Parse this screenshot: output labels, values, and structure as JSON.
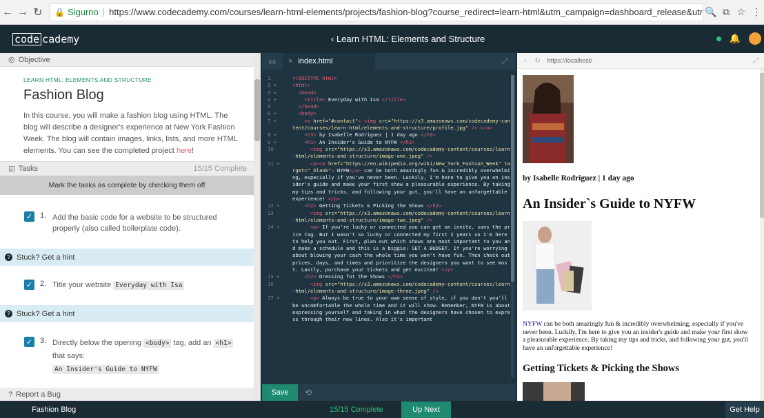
{
  "browser": {
    "secure_label": "Sigurno",
    "url": "https://www.codecademy.com/courses/learn-html-elements/projects/fashion-blog?course_redirect=learn-html&utm_campaign=dashboard_release&utm_source=codecad..."
  },
  "header": {
    "logo_code": "code",
    "logo_rest": "cademy",
    "course_link": "‹ Learn HTML: Elements and Structure"
  },
  "left": {
    "objective_label": "Objective",
    "kicker": "LEARN HTML: ELEMENTS AND STRUCTURE",
    "title": "Fashion Blog",
    "description": "In this course, you will make a fashion blog using HTML. The blog will describe a designer's experience at New York Fashion Week. The blog will contain images, links, lists, and more HTML elements. You can see the completed project ",
    "description_link": "here",
    "description_end": "!",
    "tasks_label": "Tasks",
    "tasks_count": "15/15 Complete",
    "mark_hint": "Mark the tasks as complete by checking them off",
    "tasks": [
      {
        "num": "1.",
        "text": "Add the basic code for a website to be structured properly (also called boilerplate code)."
      },
      {
        "num": "2.",
        "text_before": "Title your website ",
        "code": "Everyday with Isa"
      },
      {
        "num": "3.",
        "text_a": "Directly below the opening ",
        "code_a": "<body>",
        "text_b": " tag, add an ",
        "code_b": "<h1>",
        "text_c": " that says:",
        "code_c": "An Insider's Guide to NYFW"
      }
    ],
    "hint_label": "Stuck? Get a hint",
    "report_label": "Report a Bug"
  },
  "editor": {
    "file_name": "index.html",
    "line_numbers": [
      "1",
      "2 ▾",
      "3 ▾",
      "4 ▾",
      "5",
      "6 ▾",
      "7 ▾",
      "",
      "",
      "8 ▾",
      "9 ▾",
      "10",
      "",
      "11 ▾",
      "",
      "",
      "",
      "",
      "",
      "12 ▾",
      "13",
      "",
      "14 ▾",
      "",
      "",
      "",
      "",
      "",
      "",
      "",
      "",
      "15 ▾",
      "16",
      "",
      "",
      "17 ▾",
      "",
      "",
      ""
    ],
    "save_label": "Save"
  },
  "preview": {
    "url": "https://localhost/",
    "byline": "by Isabelle Rodriguez | 1 day ago",
    "h1": "An Insider`s Guide to NYFW",
    "para_link": "NYFW",
    "para_text": " can be both amazingly fun & incredibly overwhelming, especially if you've never been. Luckily, I'm here to give you an insider's guide and make your first show a pleasurable experience. By taking my tips and tricks, and following your gut, you'll have an unforgettable experience!",
    "h2": "Getting Tickets & Picking the Shows"
  },
  "footer": {
    "title": "Fashion Blog",
    "count": "15/15 Complete",
    "up_next": "Up Next",
    "get_help": "Get Help"
  },
  "colors": {
    "accent": "#1e8a6f",
    "tag": "#e85d75",
    "string": "#f5e2a8",
    "checkbox": "#1a7fa8"
  }
}
